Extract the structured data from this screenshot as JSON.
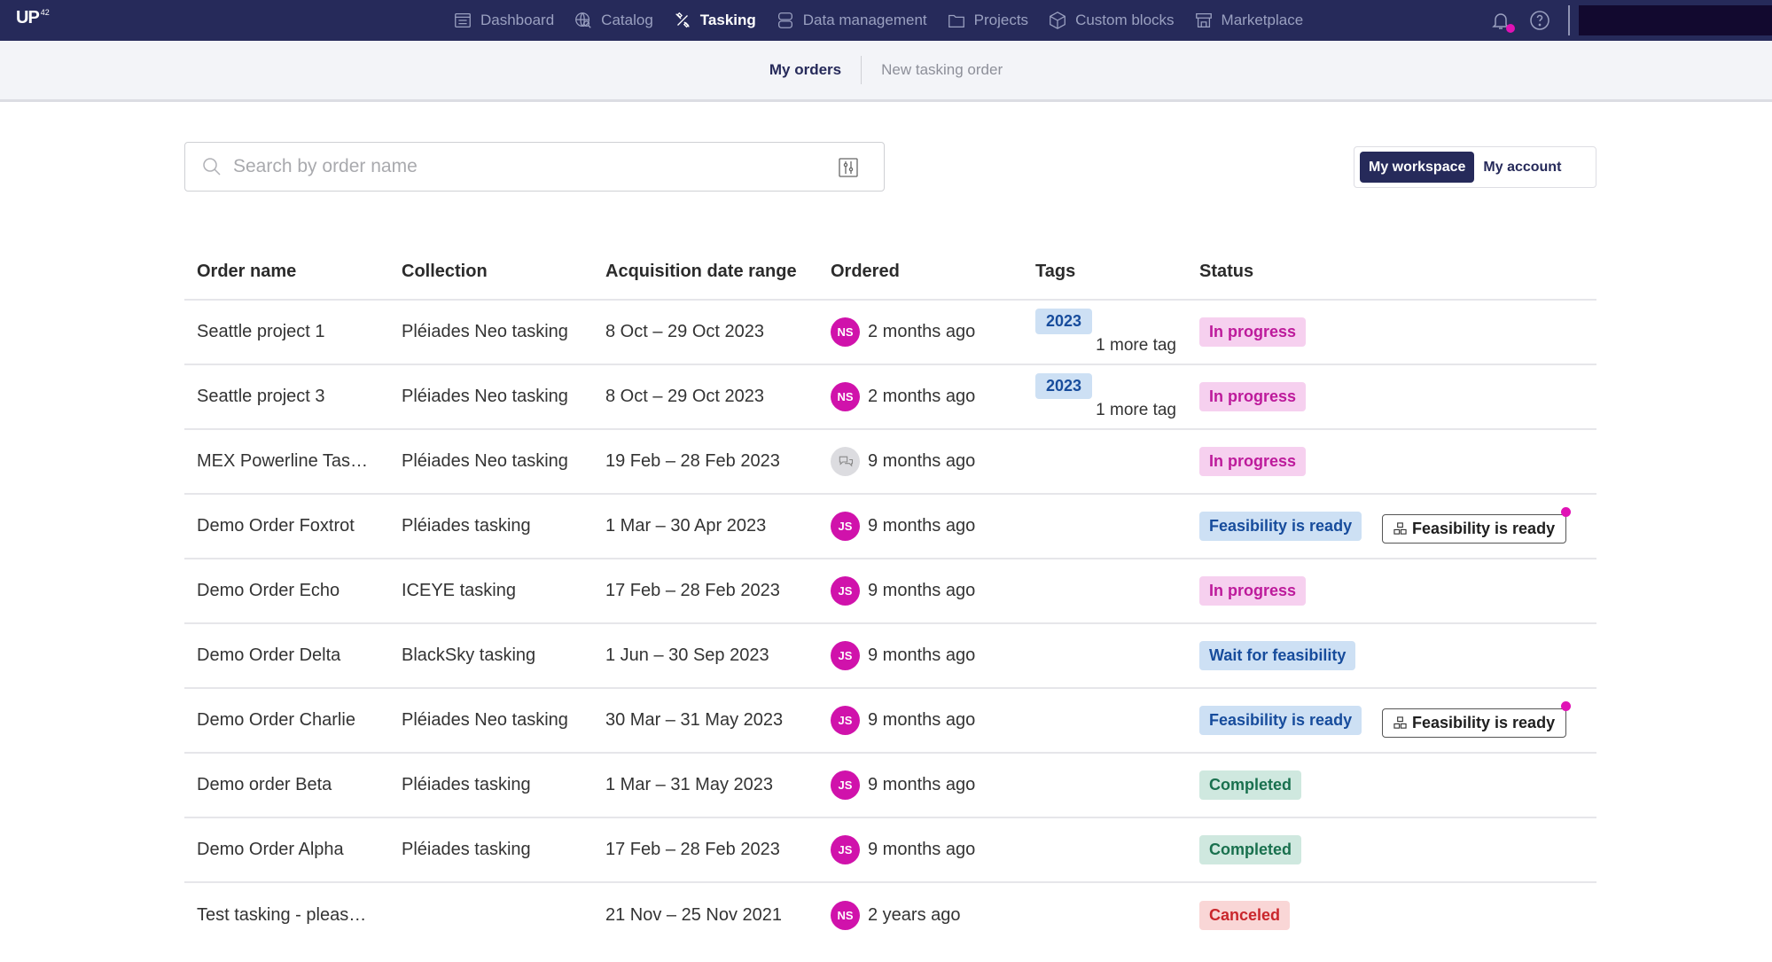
{
  "app": {
    "logo": "UP",
    "logo_sup": "42"
  },
  "nav": {
    "items": [
      {
        "label": "Dashboard",
        "icon": "dashboard-icon",
        "active": false
      },
      {
        "label": "Catalog",
        "icon": "catalog-globe-icon",
        "active": false
      },
      {
        "label": "Tasking",
        "icon": "tasking-satellite-icon",
        "active": true
      },
      {
        "label": "Data management",
        "icon": "database-icon",
        "active": false
      },
      {
        "label": "Projects",
        "icon": "folder-icon",
        "active": false
      },
      {
        "label": "Custom blocks",
        "icon": "cube-icon",
        "active": false
      },
      {
        "label": "Marketplace",
        "icon": "store-icon",
        "active": false
      }
    ]
  },
  "subnav": {
    "my_orders": "My orders",
    "new_order": "New tasking order"
  },
  "search": {
    "placeholder": "Search by order name",
    "value": ""
  },
  "scope": {
    "workspace": "My workspace",
    "account": "My account",
    "selected": "My workspace"
  },
  "table": {
    "headers": [
      "Order name",
      "Collection",
      "Acquisition date range",
      "Ordered",
      "Tags",
      "Status"
    ],
    "rows": [
      {
        "name": "Seattle project 1",
        "collection": "Pléiades Neo tasking",
        "range": "8 Oct – 29 Oct 2023",
        "initials": "NS",
        "ordered": "2 months ago",
        "tag": "2023",
        "more": "1 more tag",
        "status": "In progress",
        "status_type": "progress",
        "action": ""
      },
      {
        "name": "Seattle project 3",
        "collection": "Pléiades Neo tasking",
        "range": "8 Oct – 29 Oct 2023",
        "initials": "NS",
        "ordered": "2 months ago",
        "tag": "2023",
        "more": "1 more tag",
        "status": "In progress",
        "status_type": "progress",
        "action": ""
      },
      {
        "name": "MEX Powerline Tas…",
        "collection": "Pléiades Neo tasking",
        "range": "19 Feb – 28 Feb 2023",
        "initials": "",
        "ordered": "9 months ago",
        "tag": "",
        "more": "",
        "status": "In progress",
        "status_type": "progress",
        "action": ""
      },
      {
        "name": "Demo Order Foxtrot",
        "collection": "Pléiades tasking",
        "range": "1 Mar – 30 Apr 2023",
        "initials": "JS",
        "ordered": "9 months ago",
        "tag": "",
        "more": "",
        "status": "Feasibility is ready",
        "status_type": "feas",
        "action": "Feasibility is ready"
      },
      {
        "name": "Demo Order Echo",
        "collection": "ICEYE tasking",
        "range": "17 Feb – 28 Feb 2023",
        "initials": "JS",
        "ordered": "9 months ago",
        "tag": "",
        "more": "",
        "status": "In progress",
        "status_type": "progress",
        "action": ""
      },
      {
        "name": "Demo Order Delta",
        "collection": "BlackSky tasking",
        "range": "1 Jun – 30 Sep 2023",
        "initials": "JS",
        "ordered": "9 months ago",
        "tag": "",
        "more": "",
        "status": "Wait for feasibility",
        "status_type": "feas",
        "action": ""
      },
      {
        "name": "Demo Order Charlie",
        "collection": "Pléiades Neo tasking",
        "range": "30 Mar – 31 May 2023",
        "initials": "JS",
        "ordered": "9 months ago",
        "tag": "",
        "more": "",
        "status": "Feasibility is ready",
        "status_type": "feas",
        "action": "Feasibility is ready"
      },
      {
        "name": "Demo order Beta",
        "collection": "Pléiades tasking",
        "range": "1 Mar – 31 May 2023",
        "initials": "JS",
        "ordered": "9 months ago",
        "tag": "",
        "more": "",
        "status": "Completed",
        "status_type": "done",
        "action": ""
      },
      {
        "name": "Demo Order Alpha",
        "collection": "Pléiades tasking",
        "range": "17 Feb – 28 Feb 2023",
        "initials": "JS",
        "ordered": "9 months ago",
        "tag": "",
        "more": "",
        "status": "Completed",
        "status_type": "done",
        "action": ""
      },
      {
        "name": "Test tasking - pleas…",
        "collection": "",
        "range": "21 Nov – 25 Nov 2021",
        "initials": "NS",
        "ordered": "2 years ago",
        "tag": "",
        "more": "",
        "status": "Canceled",
        "status_type": "cancel",
        "action": ""
      }
    ]
  },
  "colors": {
    "nav_bg": "#262a5a",
    "accent": "#e012b5",
    "avatar": "#d012ab"
  }
}
